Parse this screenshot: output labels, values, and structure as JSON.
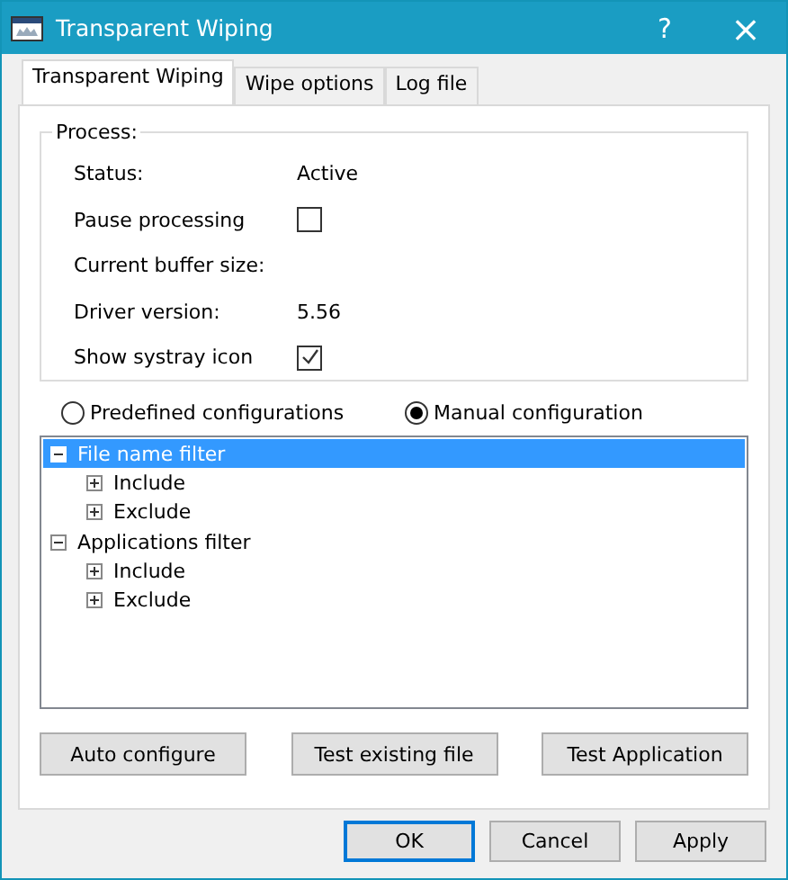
{
  "window": {
    "title": "Transparent Wiping",
    "help": "?",
    "close": "×"
  },
  "tabs": [
    {
      "label": "Transparent Wiping",
      "selected": true
    },
    {
      "label": "Wipe options",
      "selected": false
    },
    {
      "label": "Log file",
      "selected": false
    }
  ],
  "process": {
    "title": "Process:",
    "rows": [
      {
        "kind": "value",
        "label": "Status:",
        "value": "Active"
      },
      {
        "kind": "checkbox",
        "label": "Pause processing",
        "checked": false
      },
      {
        "kind": "value",
        "label": "Current buffer size:"
      },
      {
        "kind": "value",
        "label": "Driver version:",
        "value": "5.56"
      },
      {
        "kind": "checkbox",
        "label": "Show systray icon",
        "checked": true
      }
    ]
  },
  "modes": [
    {
      "label": "Predefined configurations",
      "selected": false
    },
    {
      "label": "Manual configuration",
      "selected": true
    }
  ],
  "tree": [
    {
      "label": "File name filter",
      "expanded": true,
      "selected": true,
      "children": [
        {
          "label": "Include",
          "expanded": false,
          "selected": false
        },
        {
          "label": "Exclude",
          "expanded": false,
          "selected": false
        }
      ]
    },
    {
      "label": "Applications filter",
      "expanded": true,
      "selected": false,
      "children": [
        {
          "label": "Include",
          "expanded": false,
          "selected": false
        },
        {
          "label": "Exclude",
          "expanded": false,
          "selected": false
        }
      ]
    }
  ],
  "actions": [
    "Auto configure",
    "Test existing file",
    "Test Application"
  ],
  "dialog_buttons": [
    {
      "label": "OK",
      "default": true
    },
    {
      "label": "Cancel",
      "default": false
    },
    {
      "label": "Apply",
      "default": false
    }
  ]
}
